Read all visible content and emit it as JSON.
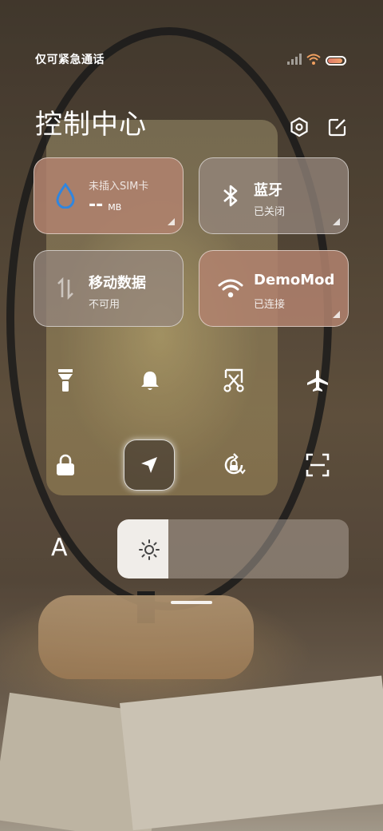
{
  "status_bar": {
    "carrier": "仅可紧急通话",
    "icons": [
      "signal-icon",
      "wifi-icon",
      "battery-icon"
    ],
    "battery_level": 0.9
  },
  "header": {
    "title": "控制中心",
    "settings_icon": "gear-icon",
    "edit_icon": "edit-icon"
  },
  "tiles": {
    "data_usage": {
      "label": "未插入SIM卡",
      "value": "--",
      "unit": "MB",
      "icon": "water-drop-icon"
    },
    "bluetooth": {
      "label": "蓝牙",
      "status": "已关闭",
      "icon": "bluetooth-icon"
    },
    "mobile_data": {
      "label": "移动数据",
      "status": "不可用",
      "icon": "arrows-updown-icon"
    },
    "wifi": {
      "label": "DemoMod",
      "status": "已连接",
      "icon": "wifi-icon"
    }
  },
  "toggles_row1": [
    "flashlight-icon",
    "bell-icon",
    "screenshot-icon",
    "airplane-icon"
  ],
  "toggles_row2": [
    "lock-icon",
    "location-icon",
    "rotation-lock-icon",
    "scan-icon"
  ],
  "brightness": {
    "auto_label": "A",
    "level": 0.22,
    "icon": "sun-icon"
  },
  "colors": {
    "accent_blue": "#2f86e0",
    "tile_warm": "#b2826e",
    "tile_gray": "#968780"
  }
}
